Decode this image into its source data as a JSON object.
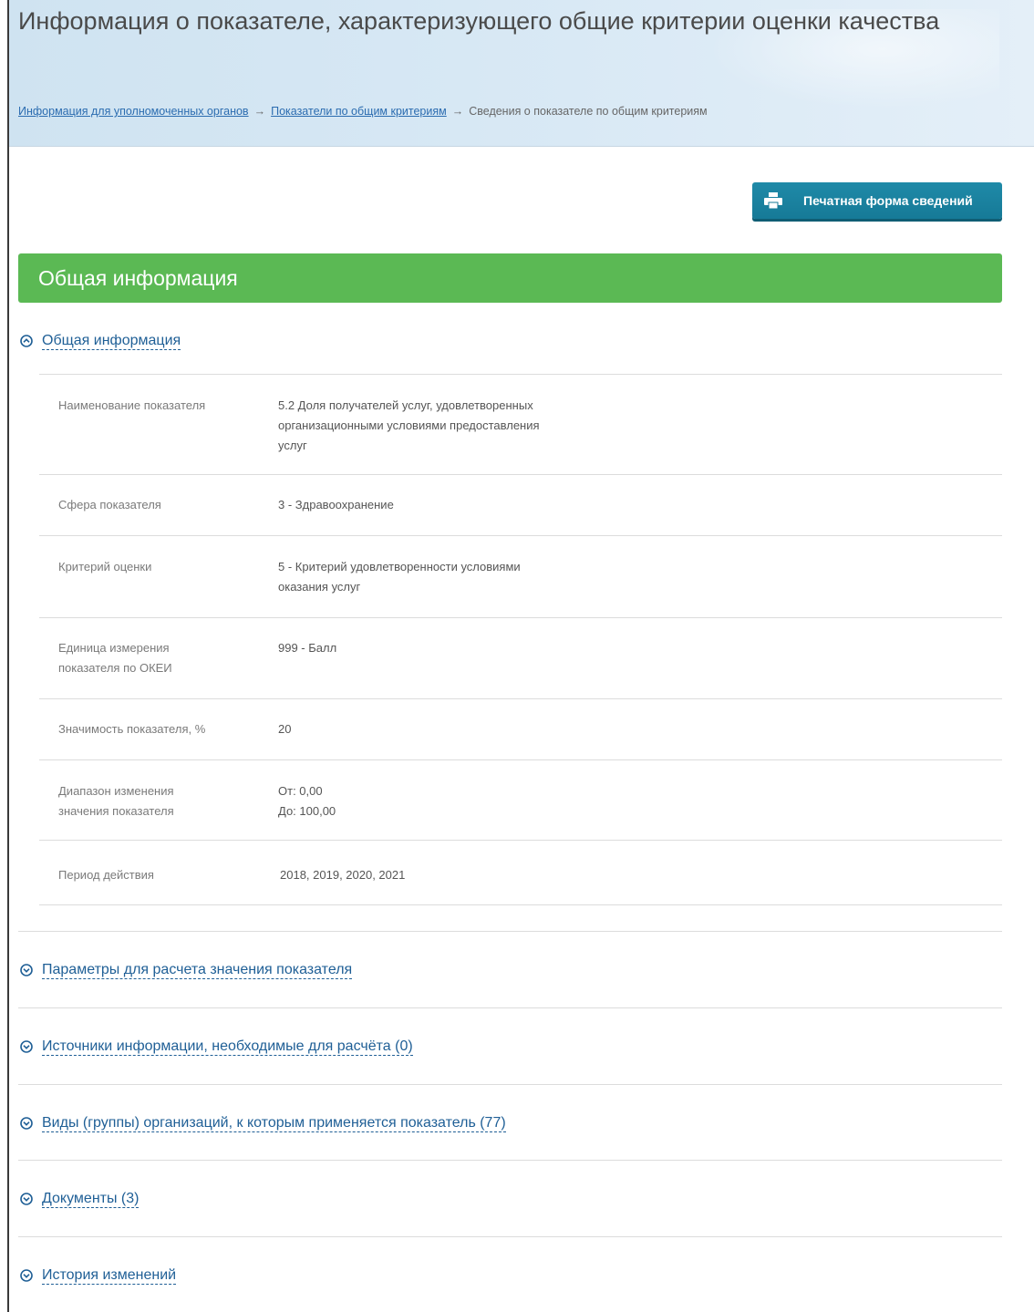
{
  "header": {
    "title": "Информация о показателе, характеризующего общие критерии оценки качества",
    "breadcrumb": {
      "link1": "Информация для уполномоченных органов",
      "link2": "Показатели по общим критериям",
      "current": "Сведения о показателе по общим критериям",
      "separator": "→"
    }
  },
  "print_button": {
    "label": "Печатная форма сведений",
    "icon": "printer-icon"
  },
  "green_bar": {
    "title": "Общая информация"
  },
  "general": {
    "title": "Общая информация",
    "rows": [
      {
        "label": "Наименование показателя",
        "value_lines": [
          "5.2 Доля получателей услуг, удовлетворенных",
          "организационными условиями предоставления",
          "услуг"
        ]
      },
      {
        "label": "Сфера показателя",
        "value_lines": [
          "3 - Здравоохранение"
        ]
      },
      {
        "label": "Критерий оценки",
        "value_lines": [
          "5 - Критерий удовлетворенности условиями",
          "оказания услуг"
        ]
      },
      {
        "label_lines": [
          "Единица измерения",
          "показателя по ОКЕИ"
        ],
        "value_lines": [
          "999 - Балл"
        ]
      },
      {
        "label": "Значимость показателя, %",
        "value_lines": [
          "20"
        ]
      },
      {
        "label_lines": [
          "Диапазон изменения",
          "значения показателя"
        ],
        "value_lines": [
          "От: 0,00",
          "До: 100,00"
        ]
      },
      {
        "label": "Период действия",
        "value_lines": [
          "2018, 2019, 2020, 2021"
        ]
      }
    ]
  },
  "sections": [
    "Параметры для расчета значения показателя",
    "Источники информации, необходимые для расчёта (0)",
    "Виды (группы) организаций, к которым применяется показатель (77)",
    "Документы (3)",
    "История изменений"
  ],
  "colors": {
    "accent_green": "#5bb954",
    "button_teal": "#1a829f",
    "link_blue": "#1f5f96"
  }
}
